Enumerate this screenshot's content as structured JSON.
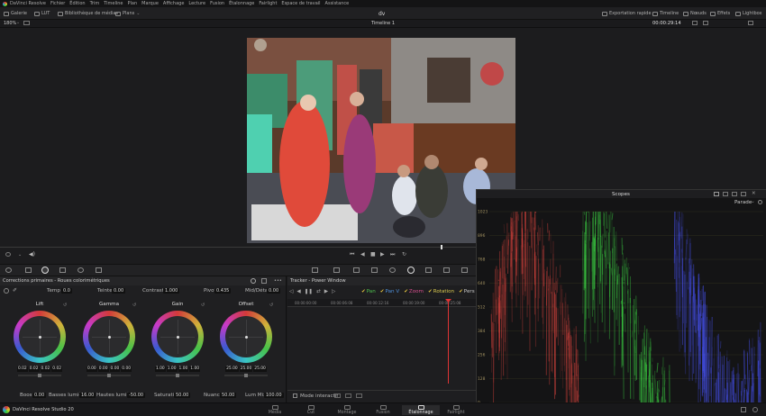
{
  "menu": {
    "items": [
      "DaVinci Resolve",
      "Fichier",
      "Édition",
      "Trim",
      "Timeline",
      "Plan",
      "Marque",
      "Affichage",
      "Lecture",
      "Fusion",
      "Étalonnage",
      "Fairlight",
      "Espace de travail",
      "Assistance"
    ]
  },
  "toolbar": {
    "gallery": "Galerie",
    "lut": "LUT",
    "media_pool": "Bibliothèque de médias",
    "clips": "Plans",
    "project_title": "dv",
    "quick_export": "Exportation rapide",
    "timeline": "Timeline",
    "nodes": "Nœuds",
    "effects": "Effets",
    "lightbox": "Lightbox"
  },
  "viewer_bar": {
    "zoom": "180%",
    "timeline_name": "Timeline 1",
    "timecode": "00:00:29:14"
  },
  "primaries": {
    "title": "Corrections primaires - Roues colorimétriques",
    "temp_label": "Temp",
    "temp_value": "0.0",
    "tint_label": "Teinte",
    "tint_value": "0.00",
    "contrast_label": "Contraste",
    "contrast_value": "1.000",
    "pivot_label": "Pivot",
    "pivot_value": "0.435",
    "middetail_label": "Mid/Détail",
    "middetail_value": "0.00",
    "wheels": [
      {
        "label": "Lift",
        "values": [
          "0.02",
          "0.02",
          "0.02",
          "0.02"
        ],
        "color": "#c9c9c9"
      },
      {
        "label": "Gamma",
        "values": [
          "0.00",
          "0.00",
          "0.00",
          "0.00"
        ],
        "color": "#c9c9c9"
      },
      {
        "label": "Gain",
        "values": [
          "1.00",
          "1.00",
          "1.00",
          "1.00"
        ],
        "color": "#c9c9c9"
      },
      {
        "label": "Offset",
        "values": [
          "25.00",
          "25.00",
          "25.00"
        ],
        "color": "#c9c9c9"
      }
    ],
    "boost_label": "Boost",
    "boost_value": "0.00",
    "shadows_label": "Basses lumières",
    "shadows_value": "16.00",
    "highlights_label": "Hautes lumières",
    "highlights_value": "-50.00",
    "saturation_label": "Saturation",
    "saturation_value": "50.00",
    "hue_label": "Nuance",
    "hue_value": "50.00",
    "lummix_label": "Lum Mix",
    "lummix_value": "100.00"
  },
  "tracker": {
    "title": "Tracker - Power Window",
    "options": [
      "Pan",
      "Pan V",
      "Zoom",
      "Rotation",
      "Pers"
    ],
    "option_colors": [
      "#4fc04f",
      "#4f8fd8",
      "#d84f8f",
      "#d8c84f",
      "#c8c8c8"
    ],
    "ruler": [
      "00:00:00:00",
      "00:00:06:08",
      "00:00:12:16",
      "00:00:19:00",
      "00:00:25:08"
    ],
    "interactive_mode": "Mode interactif"
  },
  "scopes": {
    "title": "Scopes",
    "mode": "Parade",
    "y_ticks": [
      "1023",
      "896",
      "768",
      "640",
      "512",
      "384",
      "256",
      "128",
      "0"
    ],
    "channel_colors": [
      "#e0453f",
      "#3fe047",
      "#4a55ff"
    ]
  },
  "footer": {
    "app_name": "DaVinci Resolve Studio 20",
    "pages": [
      "Média",
      "Cut",
      "Montage",
      "Fusion",
      "Étalonnage",
      "Fairlight"
    ],
    "active_page": "Étalonnage"
  }
}
